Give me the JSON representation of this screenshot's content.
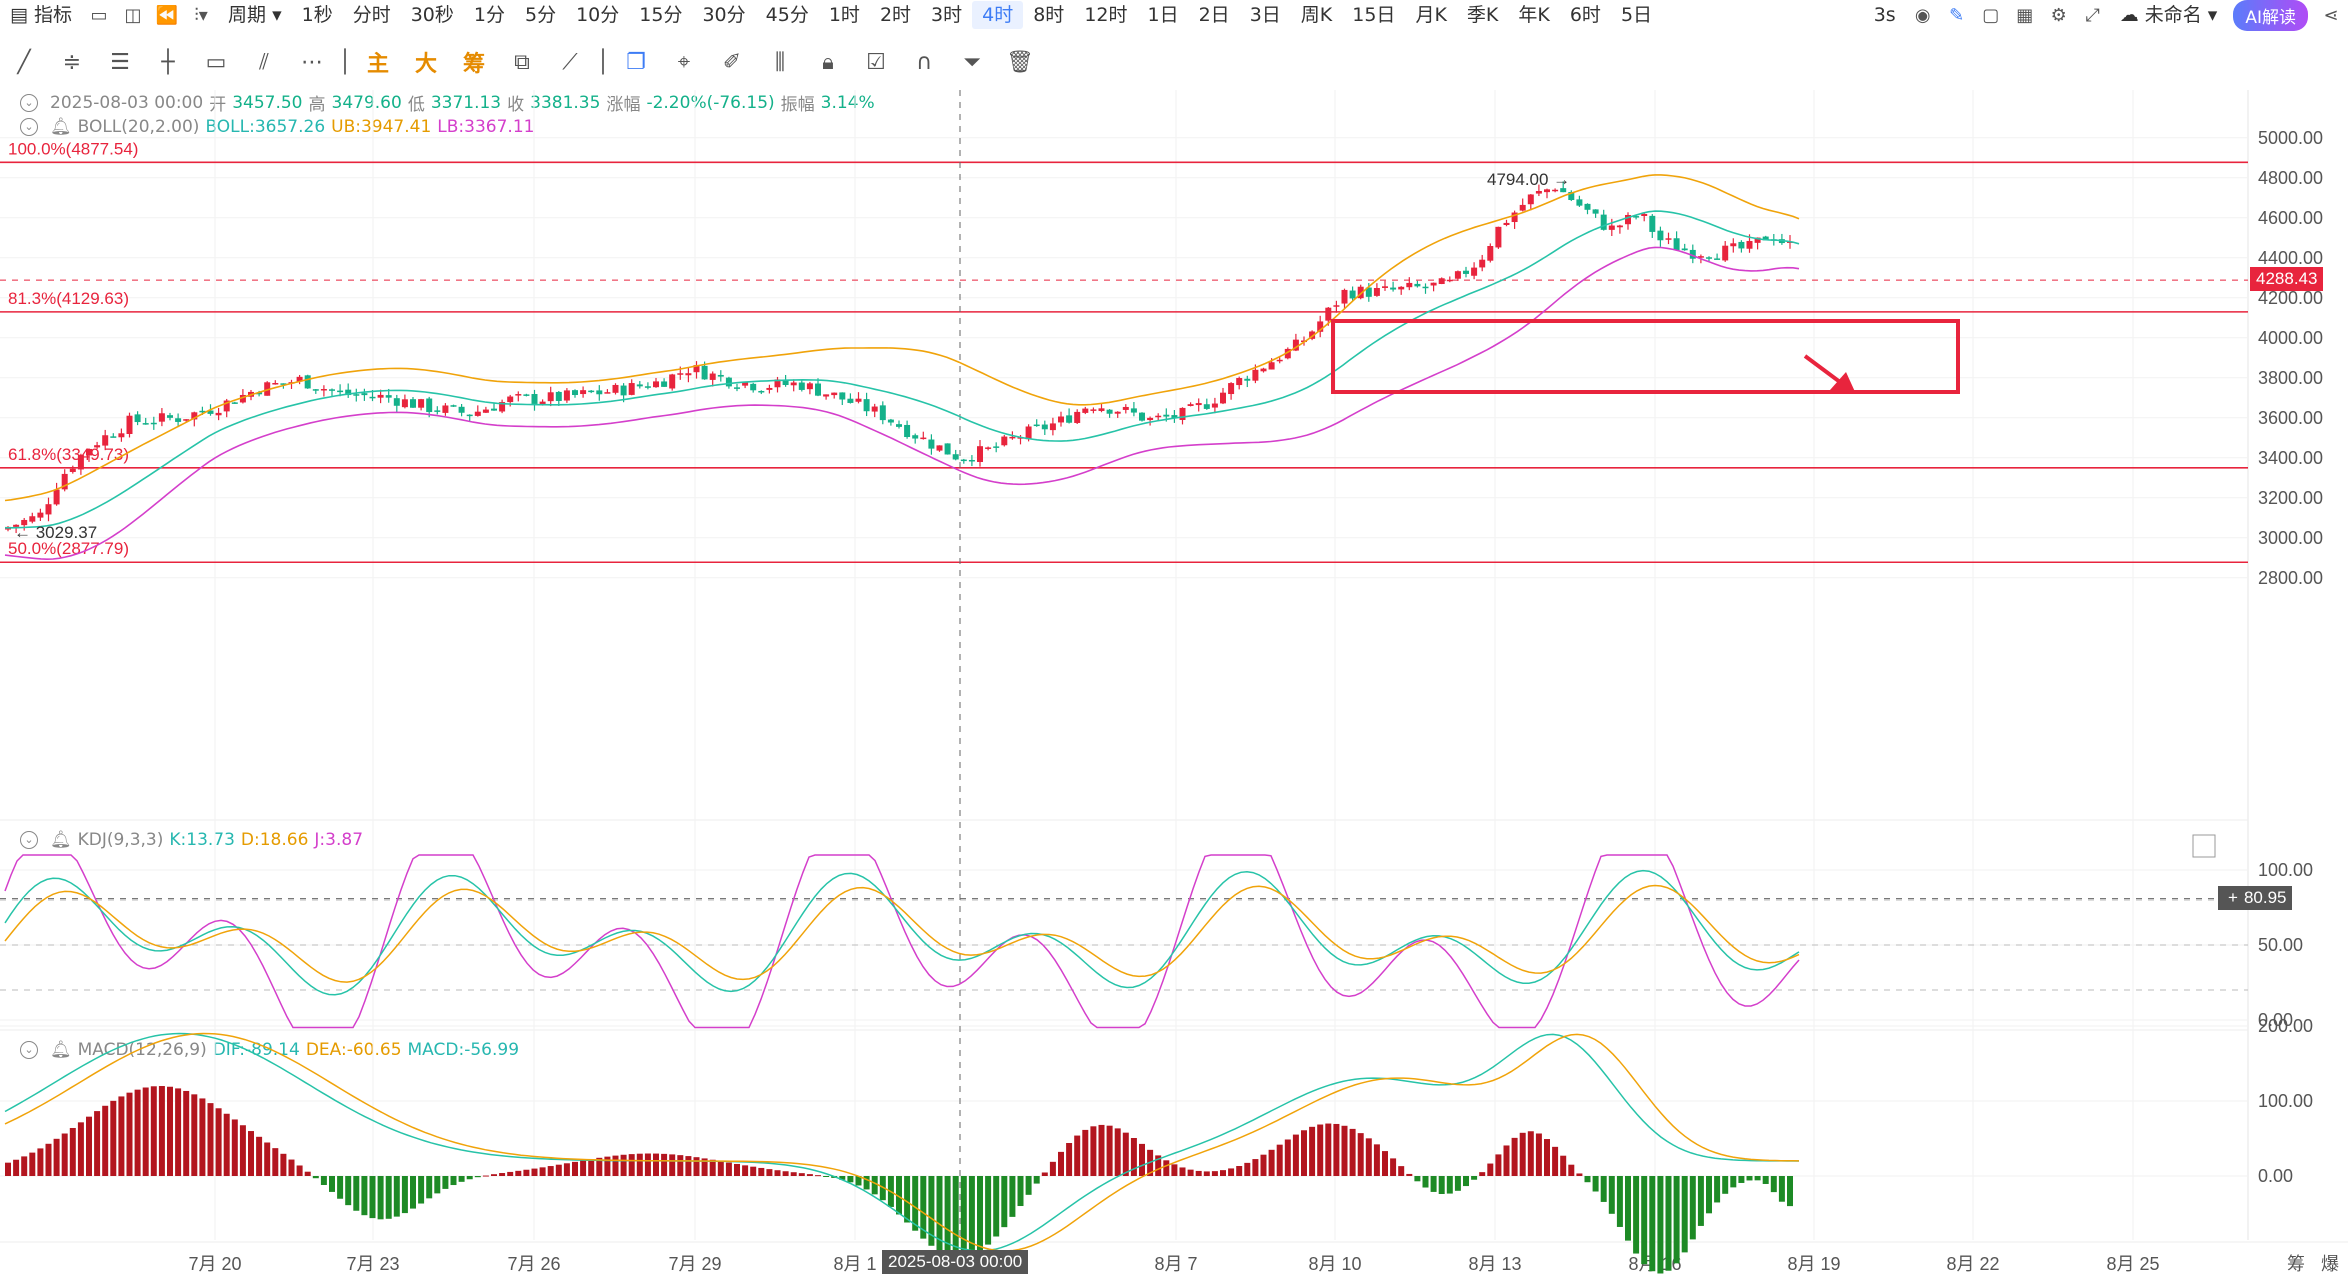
{
  "toolbar": {
    "indicator_label": "指标",
    "period_label": "周期",
    "periods": [
      "1秒",
      "分时",
      "30秒",
      "1分",
      "5分",
      "10分",
      "15分",
      "30分",
      "45分",
      "1时",
      "2时",
      "3时",
      "4时",
      "8时",
      "12时",
      "1日",
      "2日",
      "3日",
      "周K",
      "15日",
      "月K",
      "季K",
      "年K",
      "6时",
      "5日"
    ],
    "active_period": "4时",
    "refresh": "3s",
    "unnamed": "未命名",
    "ai_button": "AI解读"
  },
  "draw_tools": {
    "main": "主",
    "big": "大",
    "chip": "筹"
  },
  "ohlc": {
    "date": "2025-08-03 00:00",
    "open_label": "开",
    "open": "3457.50",
    "high_label": "高",
    "high": "3479.60",
    "low_label": "低",
    "low": "3371.13",
    "close_label": "收",
    "close": "3381.35",
    "change_label": "涨幅",
    "change": "-2.20%(-76.15)",
    "amp_label": "振幅",
    "amp": "3.14%"
  },
  "boll": {
    "name": "BOLL(20,2.00)",
    "mid": "BOLL:3657.26",
    "ub": "UB:3947.41",
    "lb": "LB:3367.11"
  },
  "kdj": {
    "name": "KDJ(9,3,3)",
    "k": "K:13.73",
    "d": "D:18.66",
    "j": "J:3.87"
  },
  "macd": {
    "name": "MACD(12,26,9)",
    "dif": "DIF:-89.14",
    "dea": "DEA:-60.65",
    "macd": "MACD:-56.99"
  },
  "fib_levels": [
    {
      "label": "100.0%(4877.54)",
      "price": 4877.54
    },
    {
      "label": "81.3%(4129.63)",
      "price": 4129.63
    },
    {
      "label": "61.8%(3349.73)",
      "price": 3349.73
    },
    {
      "label": "50.0%(2877.79)",
      "price": 2877.79
    }
  ],
  "annotations": {
    "high_marker": "4794.00",
    "low_marker": "3029.37",
    "current_price": "4288.43",
    "crosshair_value": "80.95",
    "crosshair_date": "2025-08-03 00:00"
  },
  "price_axis": [
    "5000.00",
    "4800.00",
    "4600.00",
    "4400.00",
    "4200.00",
    "4000.00",
    "3800.00",
    "3600.00",
    "3400.00",
    "3200.00",
    "3000.00",
    "2800.00"
  ],
  "kdj_axis": [
    "100.00",
    "50.00",
    "0.00"
  ],
  "macd_axis": [
    "200.00",
    "100.00",
    "0.00"
  ],
  "date_axis": [
    "7月 20",
    "7月 23",
    "7月 26",
    "7月 29",
    "8月 1",
    "8月 7",
    "8月 10",
    "8月 13",
    "8月 16",
    "8月 19",
    "8月 22",
    "8月 25"
  ],
  "bottom_right": {
    "chip": "筹",
    "burst": "爆"
  },
  "colors": {
    "up": "#e8243d",
    "down": "#14b18a",
    "boll_mid": "#27c3a8",
    "boll_ub": "#f0a30a",
    "boll_lb": "#d43fcb",
    "fib": "#e8243d",
    "highlight_box": "#e8243d"
  }
}
